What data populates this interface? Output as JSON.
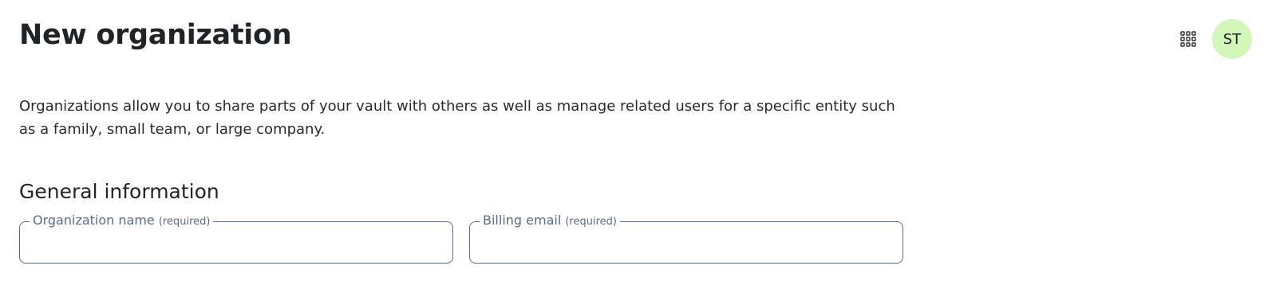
{
  "header": {
    "title": "New organization",
    "apps_icon": "apps-grid-icon",
    "avatar": {
      "initials": "ST",
      "color": "#d2f7b8"
    }
  },
  "description": "Organizations allow you to share parts of your vault with others as well as manage related users for a specific entity such as a family, small team, or large company.",
  "general_information": {
    "title": "General information",
    "fields": [
      {
        "label": "Organization name",
        "hint": "(required)",
        "value": "",
        "placeholder": ""
      },
      {
        "label": "Billing email",
        "hint": "(required)",
        "value": "",
        "placeholder": ""
      }
    ]
  },
  "colors": {
    "field_border": "#5a6a92",
    "text": "#212529"
  }
}
